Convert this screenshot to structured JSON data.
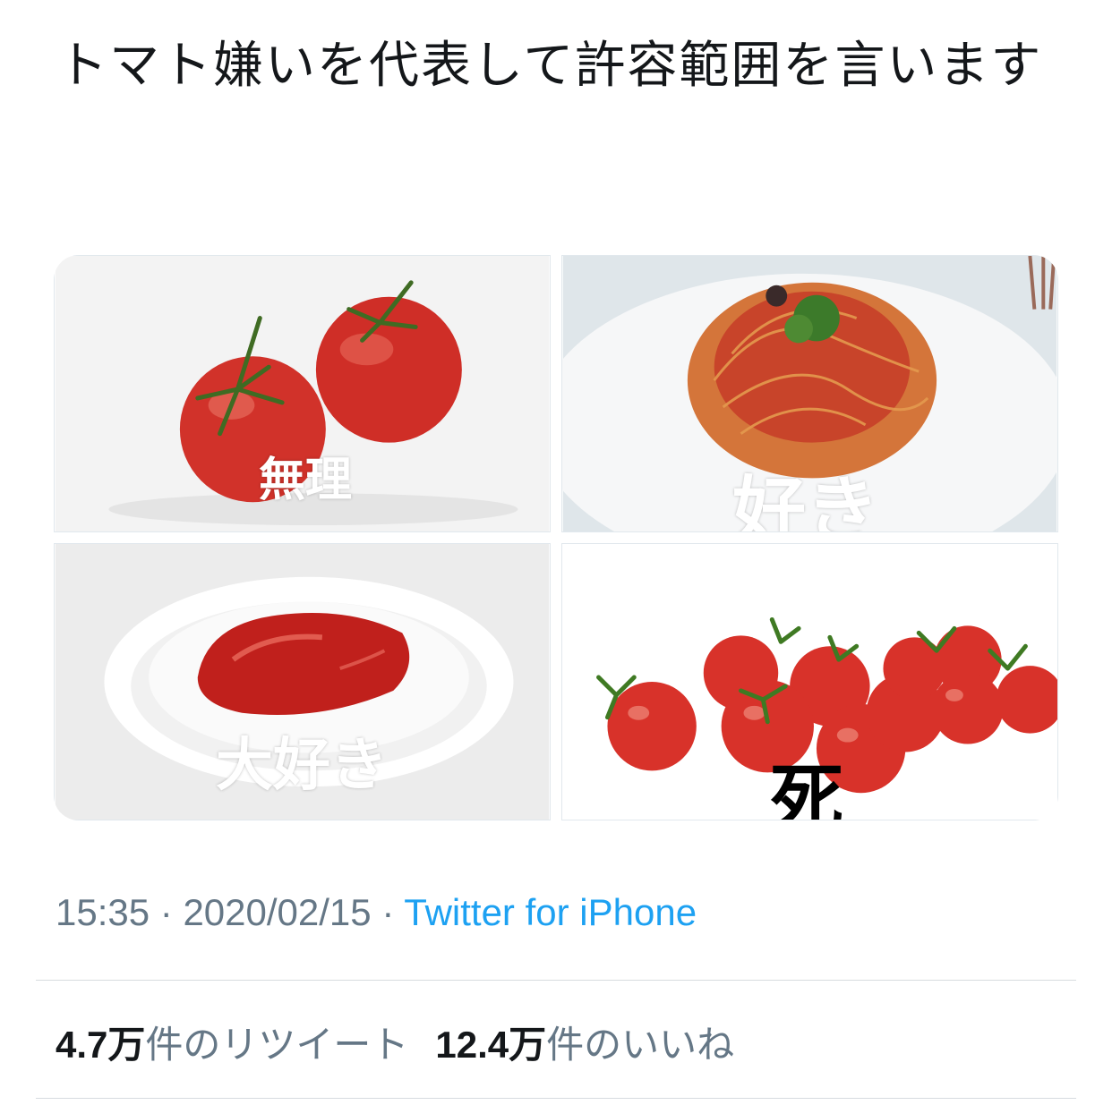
{
  "tweet": {
    "text": "トマト嫌いを代表して許容範囲を言います"
  },
  "media": [
    {
      "caption": "無理",
      "icon": "whole-tomatoes-photo"
    },
    {
      "caption": "好き",
      "icon": "tomato-pasta-photo"
    },
    {
      "caption": "大好き",
      "icon": "ketchup-dish-photo"
    },
    {
      "caption": "死",
      "icon": "cherry-tomatoes-photo"
    }
  ],
  "meta": {
    "time": "15:35",
    "sep1": " · ",
    "date": "2020/02/15",
    "sep2": " · ",
    "source": "Twitter for iPhone"
  },
  "stats": {
    "retweet_count": "4.7万",
    "retweet_label": "件のリツイート",
    "like_count": "12.4万",
    "like_label": "件のいいね"
  },
  "colors": {
    "link": "#1da1f2",
    "secondary_text": "#657786",
    "tomato_red": "#d8322a"
  }
}
